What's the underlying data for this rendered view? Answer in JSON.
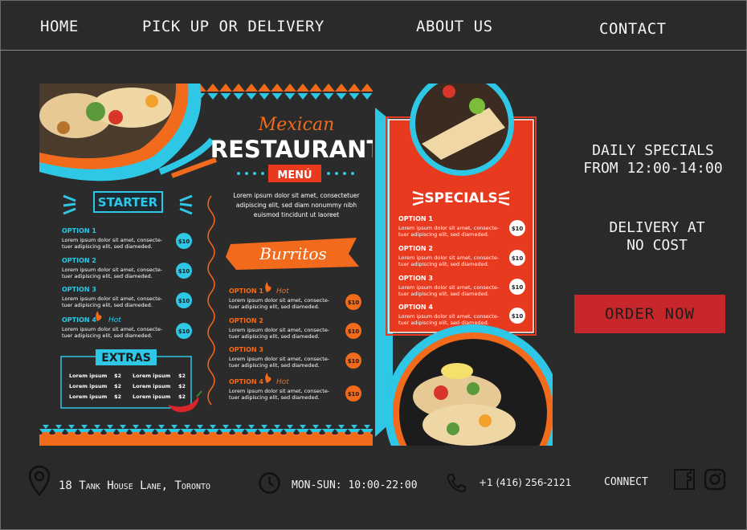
{
  "nav": {
    "home": "HOME",
    "pickup": "PICK UP OR DELIVERY",
    "about": "ABOUT US",
    "contact": "CONTACT"
  },
  "menu_image": {
    "brand_script": "Mexican",
    "brand_title": "RESTAURANT",
    "brand_sub": "MENÚ",
    "intro": [
      "Lorem ipsum dolor sit amet, consectetuer",
      "adipiscing elit, sed diam nonummy nibh",
      "euismod tincidunt ut laoreet"
    ],
    "starter": {
      "title": "STARTER",
      "items": [
        {
          "name": "OPTION 1",
          "hot": "",
          "line1": "Lorem ipsum dolor sit amet, consecte-",
          "line2": "tuer adipiscing elit, sed diameded.",
          "price": "$10"
        },
        {
          "name": "OPTION 2",
          "hot": "",
          "line1": "Lorem ipsum dolor sit amet, consecte-",
          "line2": "tuer adipiscing elit, sed diameded.",
          "price": "$10"
        },
        {
          "name": "OPTION 3",
          "hot": "",
          "line1": "Lorem ipsum dolor sit amet, consecte-",
          "line2": "tuer adipiscing elit, sed diameded.",
          "price": "$10"
        },
        {
          "name": "OPTION 4",
          "hot": "Hot",
          "line1": "Lorem ipsum dolor sit amet, consecte-",
          "line2": "tuer adipiscing elit, sed diameded.",
          "price": "$10"
        }
      ]
    },
    "extras": {
      "title": "EXTRAS",
      "items": [
        {
          "name": "Lorem ipsum",
          "price": "$2"
        },
        {
          "name": "Lorem ipsum",
          "price": "$2"
        },
        {
          "name": "Lorem ipsum",
          "price": "$2"
        },
        {
          "name": "Lorem ipsum",
          "price": "$2"
        },
        {
          "name": "Lorem ipsum",
          "price": "$2"
        },
        {
          "name": "Lorem ipsum",
          "price": "$2"
        }
      ]
    },
    "burritos": {
      "title": "Burritos",
      "items": [
        {
          "name": "OPTION 1",
          "hot": "Hot",
          "line1": "Lorem ipsum dolor sit amet, consecte-",
          "line2": "tuer adipiscing elit, sed diameded.",
          "price": "$10"
        },
        {
          "name": "OPTION 2",
          "hot": "",
          "line1": "Lorem ipsum dolor sit amet, consecte-",
          "line2": "tuer adipiscing elit, sed diameded.",
          "price": "$10"
        },
        {
          "name": "OPTION 3",
          "hot": "",
          "line1": "Lorem ipsum dolor sit amet, consecte-",
          "line2": "tuer adipiscing elit, sed diameded.",
          "price": "$10"
        },
        {
          "name": "OPTION 4",
          "hot": "Hot",
          "line1": "Lorem ipsum dolor sit amet, consecte-",
          "line2": "tuer adipiscing elit, sed diameded.",
          "price": "$10"
        }
      ]
    },
    "specials": {
      "title": "SPECIALS",
      "items": [
        {
          "name": "OPTION 1",
          "line1": "Lorem ipsum dolor sit amet, consecte-",
          "line2": "tuer adipiscing elit, sed diameded.",
          "price": "$10"
        },
        {
          "name": "OPTION 2",
          "line1": "Lorem ipsum dolor sit amet, consecte-",
          "line2": "tuer adipiscing elit, sed diameded.",
          "price": "$10"
        },
        {
          "name": "OPTION 3",
          "line1": "Lorem ipsum dolor sit amet, consecte-",
          "line2": "tuer adipiscing elit, sed diameded.",
          "price": "$10"
        },
        {
          "name": "OPTION 4",
          "line1": "Lorem ipsum dolor sit amet, consecte-",
          "line2": "tuer adipiscing elit, sed diameded.",
          "price": "$10"
        }
      ]
    }
  },
  "side": {
    "specials_line1": "DAILY SPECIALS",
    "specials_line2": "FROM 12:00-14:00",
    "delivery_line1": "DELIVERY AT",
    "delivery_line2": "NO COST",
    "order_label": "ORDER NOW"
  },
  "footer": {
    "address": "18 Tank House Lane, Toronto",
    "hours": "MON-SUN: 10:00-22:00",
    "phone": "+1 (416) 256-2121",
    "connect": "CONNECT"
  },
  "icons": {
    "address": "location-pin-icon",
    "hours": "clock-icon",
    "phone": "phone-icon",
    "facebook": "facebook-icon",
    "instagram": "instagram-icon"
  },
  "colors": {
    "page_bg": "#2a2a2a",
    "accent_red": "#c7272a",
    "menu_orange": "#f26a1b",
    "menu_cyan": "#2ec7e6",
    "menu_red": "#e83a1f"
  }
}
